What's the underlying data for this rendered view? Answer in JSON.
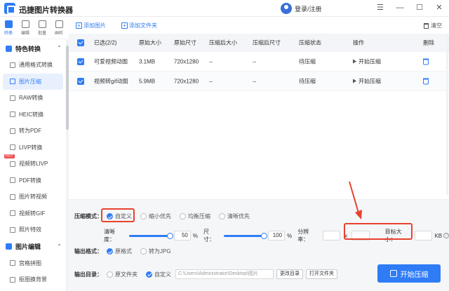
{
  "app": {
    "title": "迅捷图片转换器",
    "user_label": "登录/注册"
  },
  "window_controls": [
    "☰",
    "—",
    "☐",
    "✕"
  ],
  "top_icons": [
    {
      "label": "转换",
      "icon": "convert-icon"
    },
    {
      "label": "编辑",
      "icon": "edit-icon"
    },
    {
      "label": "批量",
      "icon": "batch-icon"
    },
    {
      "label": "画旺",
      "icon": "draw-icon"
    }
  ],
  "sidebar": {
    "group1": "特色转换",
    "items": [
      "通用格式转换",
      "图片压缩",
      "RAW转换",
      "HEIC转换",
      "转为PDF",
      "LIVP转换",
      "视频转LIVP",
      "PDF转换",
      "图片转视频",
      "视频转GIF",
      "照片特效"
    ],
    "hot_label": "HOT",
    "group2": "图片编辑",
    "items2": [
      "宫格拼图",
      "抠图换背景"
    ]
  },
  "toolbar": {
    "add_image": "添加图片",
    "add_folder": "添加文件夹",
    "clear": "清空"
  },
  "table": {
    "headers": [
      "已选(2/2)",
      "原始大小",
      "原始尺寸",
      "压缩后大小",
      "压缩后尺寸",
      "压缩状态",
      "操作",
      "删除"
    ],
    "rows": [
      {
        "name": "可爱视频动图",
        "size": "3.1MB",
        "dim": "720x1280",
        "csize": "--",
        "cdim": "--",
        "status": "待压缩",
        "action": "开始压缩"
      },
      {
        "name": "视频转gif动图",
        "size": "5.9MB",
        "dim": "720x1280",
        "csize": "--",
        "cdim": "--",
        "status": "待压缩",
        "action": "开始压缩"
      }
    ]
  },
  "settings": {
    "mode_label": "压缩模式：",
    "modes": [
      "自定义",
      "缩小优先",
      "均衡压缩",
      "清晰优先"
    ],
    "clarity_label": "清晰度：",
    "clarity_value": "50",
    "size_label": "尺寸：",
    "size_value": "100",
    "percent": "%",
    "resolution_label": "分辨率：",
    "x": "x",
    "target_label": "目标大小：",
    "target_unit": "KB",
    "output_format_label": "输出格式：",
    "formats": [
      "原格式",
      "转为JPG"
    ],
    "output_dir_label": "输出目录：",
    "dirs": [
      "原文件夹",
      "自定义"
    ],
    "path": "C:\\Users\\Administrator\\Desktop\\图片",
    "change_dir": "更改目录",
    "open_folder": "打开文件夹",
    "start": "开始压缩",
    "clarity_level": 0.5,
    "size_level": 1.0
  },
  "colors": {
    "accent": "#2f7cf6",
    "highlight": "#e8422f"
  }
}
